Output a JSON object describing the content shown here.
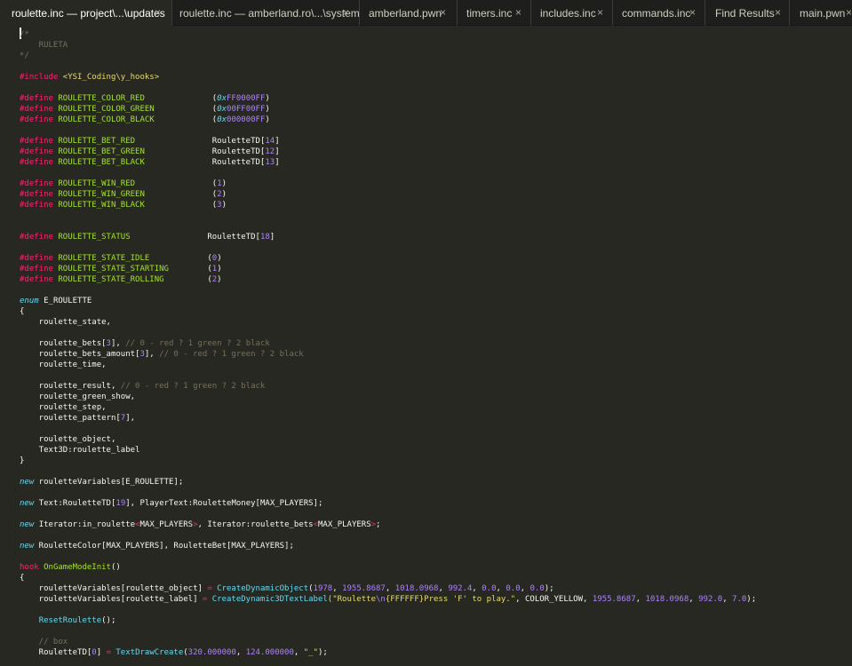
{
  "tabs": [
    {
      "label": "roulette.inc — project\\...\\updates",
      "active": true
    },
    {
      "label": "roulette.inc — amberland.ro\\...\\system",
      "active": false
    },
    {
      "label": "amberland.pwn",
      "active": false
    },
    {
      "label": "timers.inc",
      "active": false
    },
    {
      "label": "includes.inc",
      "active": false
    },
    {
      "label": "commands.inc",
      "active": false
    },
    {
      "label": "Find Results",
      "active": false
    },
    {
      "label": "main.pwn",
      "active": false
    }
  ],
  "close_glyph": "×",
  "theme": {
    "background": "#272822",
    "tabbar_background": "#1e1f1c",
    "keyword": "#f92672",
    "name": "#a6e22e",
    "number": "#ae81ff",
    "string": "#e6db74",
    "comment": "#75715e",
    "type": "#66d9ef",
    "tag": "#fd971f"
  },
  "code": [
    {
      "row": 0,
      "tokens": [
        {
          "t": "/*",
          "c": "comment"
        }
      ]
    },
    {
      "row": 1,
      "tokens": [
        {
          "t": "    RULETA",
          "c": "comment"
        }
      ]
    },
    {
      "row": 2,
      "tokens": [
        {
          "t": "*/",
          "c": "comment"
        }
      ]
    },
    {
      "row": 4,
      "tokens": [
        {
          "t": "#include",
          "c": "kw"
        },
        {
          "t": " <YSI_Coding\\y_hooks>",
          "c": "str"
        }
      ]
    },
    {
      "row": 6,
      "tokens": [
        {
          "t": "#define",
          "c": "kw"
        },
        {
          "t": " ROULETTE_COLOR_RED",
          "c": "name"
        },
        {
          "t": "              (",
          "c": "plain"
        },
        {
          "t": "0x",
          "c": "type"
        },
        {
          "t": "FF0000FF",
          "c": "num"
        },
        {
          "t": ")",
          "c": "plain"
        }
      ]
    },
    {
      "row": 7,
      "tokens": [
        {
          "t": "#define",
          "c": "kw"
        },
        {
          "t": " ROULETTE_COLOR_GREEN",
          "c": "name"
        },
        {
          "t": "            (",
          "c": "plain"
        },
        {
          "t": "0x",
          "c": "type"
        },
        {
          "t": "00FF00FF",
          "c": "num"
        },
        {
          "t": ")",
          "c": "plain"
        }
      ]
    },
    {
      "row": 8,
      "tokens": [
        {
          "t": "#define",
          "c": "kw"
        },
        {
          "t": " ROULETTE_COLOR_BLACK",
          "c": "name"
        },
        {
          "t": "            (",
          "c": "plain"
        },
        {
          "t": "0x",
          "c": "type"
        },
        {
          "t": "000000FF",
          "c": "num"
        },
        {
          "t": ")",
          "c": "plain"
        }
      ]
    },
    {
      "row": 10,
      "tokens": [
        {
          "t": "#define",
          "c": "kw"
        },
        {
          "t": " ROULETTE_BET_RED",
          "c": "name"
        },
        {
          "t": "                RouletteTD[",
          "c": "plain"
        },
        {
          "t": "14",
          "c": "num"
        },
        {
          "t": "]",
          "c": "plain"
        }
      ]
    },
    {
      "row": 11,
      "tokens": [
        {
          "t": "#define",
          "c": "kw"
        },
        {
          "t": " ROULETTE_BET_GREEN",
          "c": "name"
        },
        {
          "t": "              RouletteTD[",
          "c": "plain"
        },
        {
          "t": "12",
          "c": "num"
        },
        {
          "t": "]",
          "c": "plain"
        }
      ]
    },
    {
      "row": 12,
      "tokens": [
        {
          "t": "#define",
          "c": "kw"
        },
        {
          "t": " ROULETTE_BET_BLACK",
          "c": "name"
        },
        {
          "t": "              RouletteTD[",
          "c": "plain"
        },
        {
          "t": "13",
          "c": "num"
        },
        {
          "t": "]",
          "c": "plain"
        }
      ]
    },
    {
      "row": 14,
      "tokens": [
        {
          "t": "#define",
          "c": "kw"
        },
        {
          "t": " ROULETTE_WIN_RED",
          "c": "name"
        },
        {
          "t": "                (",
          "c": "plain"
        },
        {
          "t": "1",
          "c": "num"
        },
        {
          "t": ")",
          "c": "plain"
        }
      ]
    },
    {
      "row": 15,
      "tokens": [
        {
          "t": "#define",
          "c": "kw"
        },
        {
          "t": " ROULETTE_WIN_GREEN",
          "c": "name"
        },
        {
          "t": "              (",
          "c": "plain"
        },
        {
          "t": "2",
          "c": "num"
        },
        {
          "t": ")",
          "c": "plain"
        }
      ]
    },
    {
      "row": 16,
      "tokens": [
        {
          "t": "#define",
          "c": "kw"
        },
        {
          "t": " ROULETTE_WIN_BLACK",
          "c": "name"
        },
        {
          "t": "              (",
          "c": "plain"
        },
        {
          "t": "3",
          "c": "num"
        },
        {
          "t": ")",
          "c": "plain"
        }
      ]
    },
    {
      "row": 19,
      "tokens": [
        {
          "t": "#define",
          "c": "kw"
        },
        {
          "t": " ROULETTE_STATUS",
          "c": "name"
        },
        {
          "t": "                RouletteTD[",
          "c": "plain"
        },
        {
          "t": "18",
          "c": "num"
        },
        {
          "t": "]",
          "c": "plain"
        }
      ]
    },
    {
      "row": 21,
      "tokens": [
        {
          "t": "#define",
          "c": "kw"
        },
        {
          "t": " ROULETTE_STATE_IDLE",
          "c": "name"
        },
        {
          "t": "            (",
          "c": "plain"
        },
        {
          "t": "0",
          "c": "num"
        },
        {
          "t": ")",
          "c": "plain"
        }
      ]
    },
    {
      "row": 22,
      "tokens": [
        {
          "t": "#define",
          "c": "kw"
        },
        {
          "t": " ROULETTE_STATE_STARTING",
          "c": "name"
        },
        {
          "t": "        (",
          "c": "plain"
        },
        {
          "t": "1",
          "c": "num"
        },
        {
          "t": ")",
          "c": "plain"
        }
      ]
    },
    {
      "row": 23,
      "tokens": [
        {
          "t": "#define",
          "c": "kw"
        },
        {
          "t": " ROULETTE_STATE_ROLLING",
          "c": "name"
        },
        {
          "t": "         (",
          "c": "plain"
        },
        {
          "t": "2",
          "c": "num"
        },
        {
          "t": ")",
          "c": "plain"
        }
      ]
    },
    {
      "row": 25,
      "tokens": [
        {
          "t": "enum",
          "c": "type"
        },
        {
          "t": " E_ROULETTE",
          "c": "plain"
        }
      ]
    },
    {
      "row": 26,
      "tokens": [
        {
          "t": "{",
          "c": "plain"
        }
      ]
    },
    {
      "row": 27,
      "tokens": [
        {
          "t": "    roulette_state,",
          "c": "plain"
        }
      ]
    },
    {
      "row": 29,
      "tokens": [
        {
          "t": "    roulette_bets[",
          "c": "plain"
        },
        {
          "t": "3",
          "c": "num"
        },
        {
          "t": "], ",
          "c": "plain"
        },
        {
          "t": "// 0 - red ? 1 green ? 2 black",
          "c": "comment"
        }
      ]
    },
    {
      "row": 30,
      "tokens": [
        {
          "t": "    roulette_bets_amount[",
          "c": "plain"
        },
        {
          "t": "3",
          "c": "num"
        },
        {
          "t": "], ",
          "c": "plain"
        },
        {
          "t": "// 0 - red ? 1 green ? 2 black",
          "c": "comment"
        }
      ]
    },
    {
      "row": 31,
      "tokens": [
        {
          "t": "    roulette_time,",
          "c": "plain"
        }
      ]
    },
    {
      "row": 33,
      "tokens": [
        {
          "t": "    roulette_result, ",
          "c": "plain"
        },
        {
          "t": "// 0 - red ? 1 green ? 2 black",
          "c": "comment"
        }
      ]
    },
    {
      "row": 34,
      "tokens": [
        {
          "t": "    roulette_green_show,",
          "c": "plain"
        }
      ]
    },
    {
      "row": 35,
      "tokens": [
        {
          "t": "    roulette_step,",
          "c": "plain"
        }
      ]
    },
    {
      "row": 36,
      "tokens": [
        {
          "t": "    roulette_pattern[",
          "c": "plain"
        },
        {
          "t": "7",
          "c": "num"
        },
        {
          "t": "],",
          "c": "plain"
        }
      ]
    },
    {
      "row": 38,
      "tokens": [
        {
          "t": "    roulette_object,",
          "c": "plain"
        }
      ]
    },
    {
      "row": 39,
      "tokens": [
        {
          "t": "    ",
          "c": "plain"
        },
        {
          "t": "Text3D",
          "c": "tag"
        },
        {
          "t": ":roulette_label",
          "c": "plain"
        }
      ]
    },
    {
      "row": 40,
      "tokens": [
        {
          "t": "}",
          "c": "plain"
        }
      ]
    },
    {
      "row": 42,
      "tokens": [
        {
          "t": "new",
          "c": "type"
        },
        {
          "t": " rouletteVariables[E_ROULETTE];",
          "c": "plain"
        }
      ]
    },
    {
      "row": 44,
      "tokens": [
        {
          "t": "new",
          "c": "type"
        },
        {
          "t": " ",
          "c": "plain"
        },
        {
          "t": "Text",
          "c": "tag"
        },
        {
          "t": ":RouletteTD[",
          "c": "plain"
        },
        {
          "t": "19",
          "c": "num"
        },
        {
          "t": "], ",
          "c": "plain"
        },
        {
          "t": "PlayerText",
          "c": "tag"
        },
        {
          "t": ":RouletteMoney[MAX_PLAYERS];",
          "c": "plain"
        }
      ]
    },
    {
      "row": 46,
      "tokens": [
        {
          "t": "new",
          "c": "type"
        },
        {
          "t": " ",
          "c": "plain"
        },
        {
          "t": "Iterator",
          "c": "tag"
        },
        {
          "t": ":in_roulette",
          "c": "plain"
        },
        {
          "t": "<",
          "c": "kw"
        },
        {
          "t": "MAX_PLAYERS",
          "c": "plain"
        },
        {
          "t": ">",
          "c": "kw"
        },
        {
          "t": ", ",
          "c": "plain"
        },
        {
          "t": "Iterator",
          "c": "tag"
        },
        {
          "t": ":roulette_bets",
          "c": "plain"
        },
        {
          "t": "<",
          "c": "kw"
        },
        {
          "t": "MAX_PLAYERS",
          "c": "plain"
        },
        {
          "t": ">",
          "c": "kw"
        },
        {
          "t": ";",
          "c": "plain"
        }
      ]
    },
    {
      "row": 48,
      "tokens": [
        {
          "t": "new",
          "c": "type"
        },
        {
          "t": " RouletteColor[MAX_PLAYERS], RouletteBet[MAX_PLAYERS];",
          "c": "plain"
        }
      ]
    },
    {
      "row": 50,
      "tokens": [
        {
          "t": "hook",
          "c": "kw"
        },
        {
          "t": " ",
          "c": "plain"
        },
        {
          "t": "OnGameModeInit",
          "c": "name"
        },
        {
          "t": "()",
          "c": "plain"
        }
      ]
    },
    {
      "row": 51,
      "tokens": [
        {
          "t": "{",
          "c": "plain"
        }
      ]
    },
    {
      "row": 52,
      "tokens": [
        {
          "t": "    rouletteVariables[roulette_object] ",
          "c": "plain"
        },
        {
          "t": "=",
          "c": "kw"
        },
        {
          "t": " ",
          "c": "plain"
        },
        {
          "t": "CreateDynamicObject",
          "c": "func"
        },
        {
          "t": "(",
          "c": "plain"
        },
        {
          "t": "1978",
          "c": "num"
        },
        {
          "t": ", ",
          "c": "plain"
        },
        {
          "t": "1955.8687",
          "c": "num"
        },
        {
          "t": ", ",
          "c": "plain"
        },
        {
          "t": "1018.0968",
          "c": "num"
        },
        {
          "t": ", ",
          "c": "plain"
        },
        {
          "t": "992.4",
          "c": "num"
        },
        {
          "t": ", ",
          "c": "plain"
        },
        {
          "t": "0.0",
          "c": "num"
        },
        {
          "t": ", ",
          "c": "plain"
        },
        {
          "t": "0.0",
          "c": "num"
        },
        {
          "t": ", ",
          "c": "plain"
        },
        {
          "t": "0.0",
          "c": "num"
        },
        {
          "t": ");",
          "c": "plain"
        }
      ]
    },
    {
      "row": 53,
      "tokens": [
        {
          "t": "    rouletteVariables[roulette_label] ",
          "c": "plain"
        },
        {
          "t": "=",
          "c": "kw"
        },
        {
          "t": " ",
          "c": "plain"
        },
        {
          "t": "CreateDynamic3DTextLabel",
          "c": "func"
        },
        {
          "t": "(\"Roulette",
          "c": "str"
        },
        {
          "t": "\\n",
          "c": "num"
        },
        {
          "t": "{FFFFFF}Press 'F' to play.\"",
          "c": "str"
        },
        {
          "t": ", COLOR_YELLOW, ",
          "c": "plain"
        },
        {
          "t": "1955.8687",
          "c": "num"
        },
        {
          "t": ", ",
          "c": "plain"
        },
        {
          "t": "1018.0968",
          "c": "num"
        },
        {
          "t": ", ",
          "c": "plain"
        },
        {
          "t": "992.0",
          "c": "num"
        },
        {
          "t": ", ",
          "c": "plain"
        },
        {
          "t": "7.0",
          "c": "num"
        },
        {
          "t": ");",
          "c": "plain"
        }
      ]
    },
    {
      "row": 55,
      "tokens": [
        {
          "t": "    ",
          "c": "plain"
        },
        {
          "t": "ResetRoulette",
          "c": "func"
        },
        {
          "t": "();",
          "c": "plain"
        }
      ]
    },
    {
      "row": 57,
      "tokens": [
        {
          "t": "    // box",
          "c": "comment"
        }
      ]
    },
    {
      "row": 58,
      "tokens": [
        {
          "t": "    RouletteTD[",
          "c": "plain"
        },
        {
          "t": "0",
          "c": "num"
        },
        {
          "t": "] ",
          "c": "plain"
        },
        {
          "t": "=",
          "c": "kw"
        },
        {
          "t": " ",
          "c": "plain"
        },
        {
          "t": "TextDrawCreate",
          "c": "func"
        },
        {
          "t": "(",
          "c": "plain"
        },
        {
          "t": "320.000000",
          "c": "num"
        },
        {
          "t": ", ",
          "c": "plain"
        },
        {
          "t": "124.000000",
          "c": "num"
        },
        {
          "t": ", ",
          "c": "plain"
        },
        {
          "t": "\"_\"",
          "c": "str"
        },
        {
          "t": ");",
          "c": "plain"
        }
      ]
    }
  ]
}
